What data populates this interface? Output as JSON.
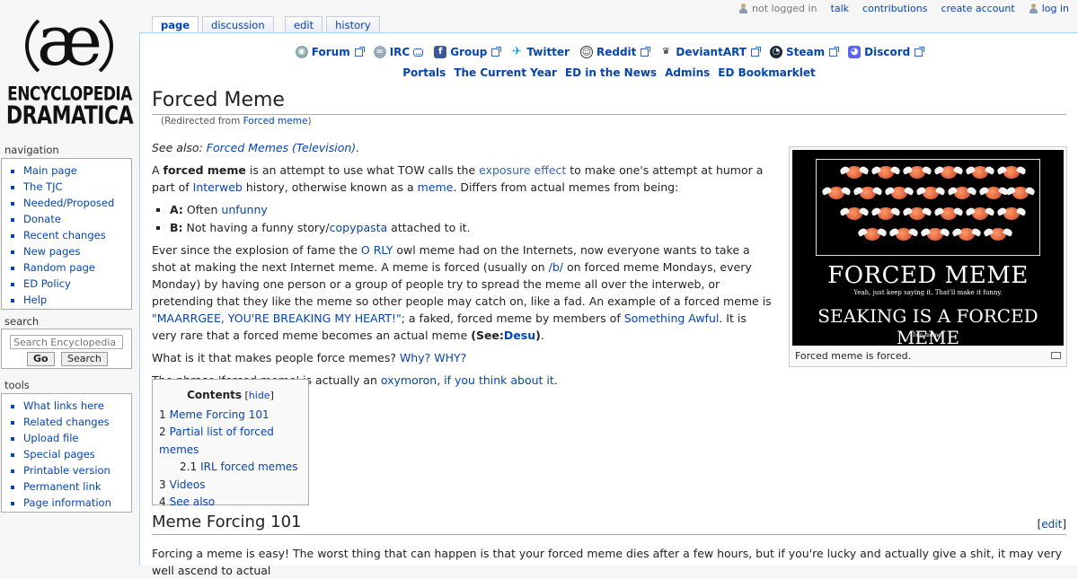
{
  "logo": {
    "glyph": "æ",
    "line1": "ENCYCLOPEDIA",
    "line2": "DRAMATICA"
  },
  "personal": {
    "not_logged_in": "not logged in",
    "talk": "talk",
    "contributions": "contributions",
    "create_account": "create account",
    "log_in": "log in"
  },
  "tabs": {
    "page": "page",
    "discussion": "discussion",
    "edit": "edit",
    "history": "history"
  },
  "sitenotice": {
    "links": [
      "Forum",
      "IRC",
      "Group",
      "Twitter",
      "Reddit",
      "DeviantART",
      "Steam",
      "Discord"
    ],
    "links2": [
      "Portals",
      "The Current Year",
      "ED in the News",
      "Admins",
      "ED Bookmarklet"
    ]
  },
  "page": {
    "title": "Forced Meme",
    "redirect_prefix": "(Redirected from ",
    "redirect_link": "Forced meme",
    "redirect_suffix": ")"
  },
  "body": {
    "see_also_label": "See also: ",
    "see_also_link": "Forced Memes (Television)",
    "p1_a": "A ",
    "p1_bold": "forced meme",
    "p1_b": " is an attempt to use what TOW calls the ",
    "p1_link1": "exposure effect",
    "p1_c": " to make one's attempt at humor a part of ",
    "p1_link2": "Interweb",
    "p1_d": " history, otherwise known as a ",
    "p1_link3": "meme",
    "p1_e": ". Differs from actual memes from being:",
    "li1_bold": "A:",
    "li1_text": " Often ",
    "li1_link": "unfunny",
    "li2_bold": "B:",
    "li2_text": " Not having a funny story/",
    "li2_link": "copypasta",
    "li2_end": " attached to it.",
    "p2_a": "Ever since the explosion of fame the ",
    "p2_link1": "O RLY",
    "p2_b": " owl meme had on the Internets, now everyone wants to take a shot at making the next Internet meme. A meme is forced (usually on ",
    "p2_link2": "/b/",
    "p2_c": " on forced meme Mondays, every Monday) by having one person or a group of people try to spread the meme all over the interweb, or pretending that they like the meme so other people may catch on, like a fad. An example of a forced meme is ",
    "p2_link3": "\"MAARRGEE, YOU'RE BREAKING MY HEART!\"",
    "p2_d": "; a faked, forced meme by members of ",
    "p2_link4": "Something Awful",
    "p2_e": ". It is very rare that a forced meme becomes an actual meme ",
    "p2_bold": "(See:",
    "p2_link5": "Desu",
    "p2_bold_end": ")",
    "p2_end": ".",
    "p3_a": "What is it that makes people force memes? ",
    "p3_link": "Why? WHY?",
    "p4_a": "The phrase 'forced meme' is actually an ",
    "p4_link1": "oxymoron",
    "p4_b": ", ",
    "p4_link2": "if you think about it",
    "p4_end": "."
  },
  "thumb": {
    "line1": "FORCED MEME",
    "line2": "Yeah, just keep saying it.  That'll make it funny.",
    "line3": "SEAKING IS A FORCED MEME",
    "line4": "Is a meme.",
    "caption": "Forced meme is forced."
  },
  "toc": {
    "title": "Contents",
    "hide_open": " [",
    "hide": "hide",
    "hide_close": "]",
    "items": [
      {
        "num": "1",
        "label": "Meme Forcing 101"
      },
      {
        "num": "2",
        "label": "Partial list of forced memes"
      },
      {
        "num": "2.1",
        "label": "IRL forced memes"
      },
      {
        "num": "3",
        "label": "Videos"
      },
      {
        "num": "4",
        "label": "See also"
      }
    ]
  },
  "section": {
    "heading": "Meme Forcing 101",
    "edit_open": "[",
    "edit": "edit",
    "edit_close": "]",
    "text": "Forcing a meme is easy! The worst thing that can happen is that your forced meme dies after a few hours, but if you're lucky and actually give a shit, it may very well ascend to actual"
  },
  "sidebar": {
    "navigation": {
      "heading": "navigation",
      "items": [
        "Main page",
        "The TJC",
        "Needed/Proposed",
        "Donate",
        "Recent changes",
        "New pages",
        "Random page",
        "ED Policy",
        "Help"
      ]
    },
    "search": {
      "heading": "search",
      "placeholder": "Search Encyclopedia",
      "go": "Go",
      "search": "Search"
    },
    "tools": {
      "heading": "tools",
      "items": [
        "What links here",
        "Related changes",
        "Upload file",
        "Special pages",
        "Printable version",
        "Permanent link",
        "Page information"
      ]
    }
  },
  "colors": {
    "link": "#0645ad",
    "external_link": "#3366bb",
    "border": "#a7d7f9"
  }
}
